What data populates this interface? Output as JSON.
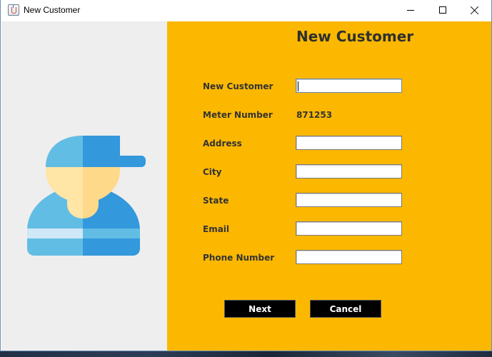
{
  "window": {
    "title": "New Customer"
  },
  "colors": {
    "form_background": "#fcb800",
    "left_panel_background": "#eeeeee",
    "button_background": "#000000",
    "button_text": "#ffffff"
  },
  "illustration": {
    "icon": "customer-worker-with-cap-icon"
  },
  "form": {
    "heading": "New Customer",
    "fields": {
      "name": {
        "label": "New Customer",
        "value": ""
      },
      "meter": {
        "label": "Meter Number",
        "value": "871253"
      },
      "address": {
        "label": "Address",
        "value": ""
      },
      "city": {
        "label": "City",
        "value": ""
      },
      "state": {
        "label": "State",
        "value": ""
      },
      "email": {
        "label": "Email",
        "value": ""
      },
      "phone": {
        "label": "Phone Number",
        "value": ""
      }
    },
    "buttons": {
      "next": "Next",
      "cancel": "Cancel"
    }
  }
}
